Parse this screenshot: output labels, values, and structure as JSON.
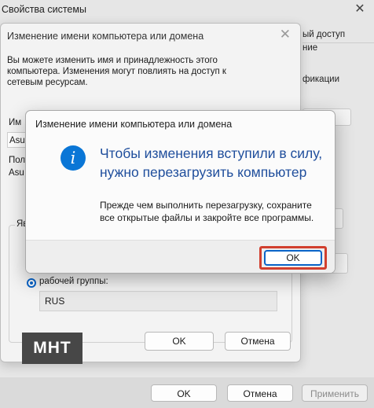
{
  "system_properties": {
    "title": "Свойства системы",
    "close_glyph": "✕",
    "tab_fragment_1": "ый доступ",
    "tab_fragment_2": "ние",
    "text_fragment": "фикации",
    "footer": {
      "ok_label": "OK",
      "cancel_label": "Отмена",
      "apply_label": "Применить"
    }
  },
  "rename_dialog": {
    "title": "Изменение имени компьютера или домена",
    "close_glyph": "✕",
    "info_text": "Вы можете изменить имя и принадлежность этого компьютера. Изменения могут повлиять на доступ к сетевым ресурсам.",
    "computer_name_label_fragment": "Им",
    "computer_name_value_fragment": "Asu",
    "full_name_label_fragment": "Пол",
    "full_name_value_fragment": "Asu",
    "member_of_label_fragment": "Яв",
    "workgroup_label": "рабочей группы:",
    "workgroup_value": "RUS",
    "ok_label": "OK",
    "cancel_label": "Отмена"
  },
  "restart_prompt": {
    "title": "Изменение имени компьютера или домена",
    "icon": "info-icon",
    "heading": "Чтобы изменения вступили в силу, нужно перезагрузить компьютер",
    "body": "Прежде чем выполнить перезагрузку, сохраните все открытые файлы и закройте все программы.",
    "ok_label": "OK",
    "highlight_color": "#d13f2e"
  },
  "watermark": {
    "text": "MHT"
  }
}
